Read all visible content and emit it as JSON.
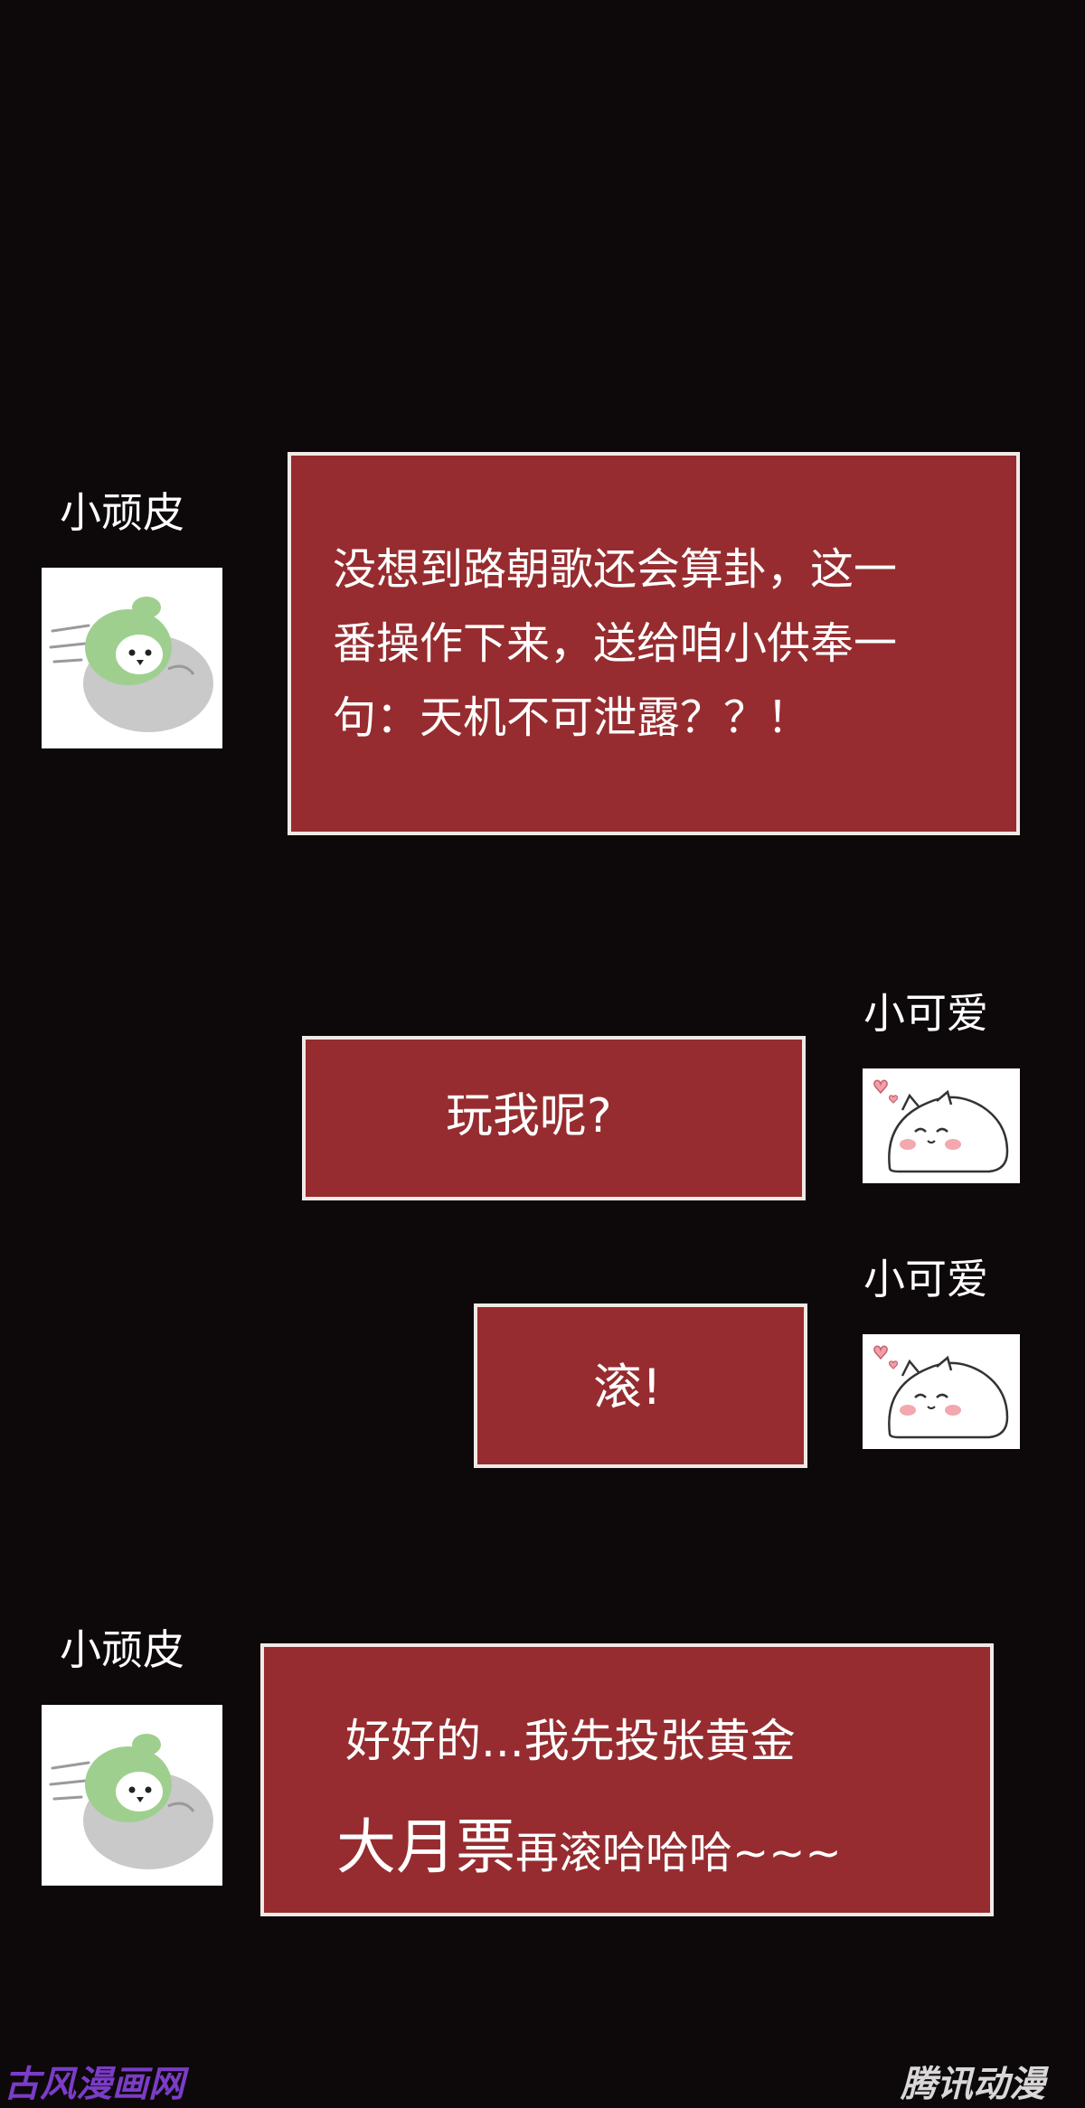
{
  "messages": [
    {
      "sender": "小顽皮",
      "side": "left",
      "avatar_icon": "penguin-in-green-hood-icon",
      "lines": [
        "没想到路朝歌还会算卦，这一",
        "番操作下来，送给咱小供奉一",
        "句：天机不可泄露？？！"
      ]
    },
    {
      "sender": "小可爱",
      "side": "right",
      "avatar_icon": "white-blob-cat-with-hearts-icon",
      "lines": [
        "玩我呢?"
      ]
    },
    {
      "sender": "小可爱",
      "side": "right",
      "avatar_icon": "white-blob-cat-with-hearts-icon",
      "lines": [
        "滚!"
      ]
    },
    {
      "sender": "小顽皮",
      "side": "left",
      "avatar_icon": "penguin-in-green-hood-icon",
      "line1": "好好的...我先投张黄金",
      "line2_big": "大月票",
      "line2_rest": "再滚哈哈哈~~~"
    }
  ],
  "watermarks": {
    "left": "古风漫画网",
    "right": "腾讯动漫"
  },
  "colors": {
    "background": "#0d0809",
    "bubble_fill": "#962c2f",
    "bubble_border": "#f1e9e6",
    "watermark_left": "#7b3cc7",
    "watermark_right": "#d8d8d8"
  }
}
